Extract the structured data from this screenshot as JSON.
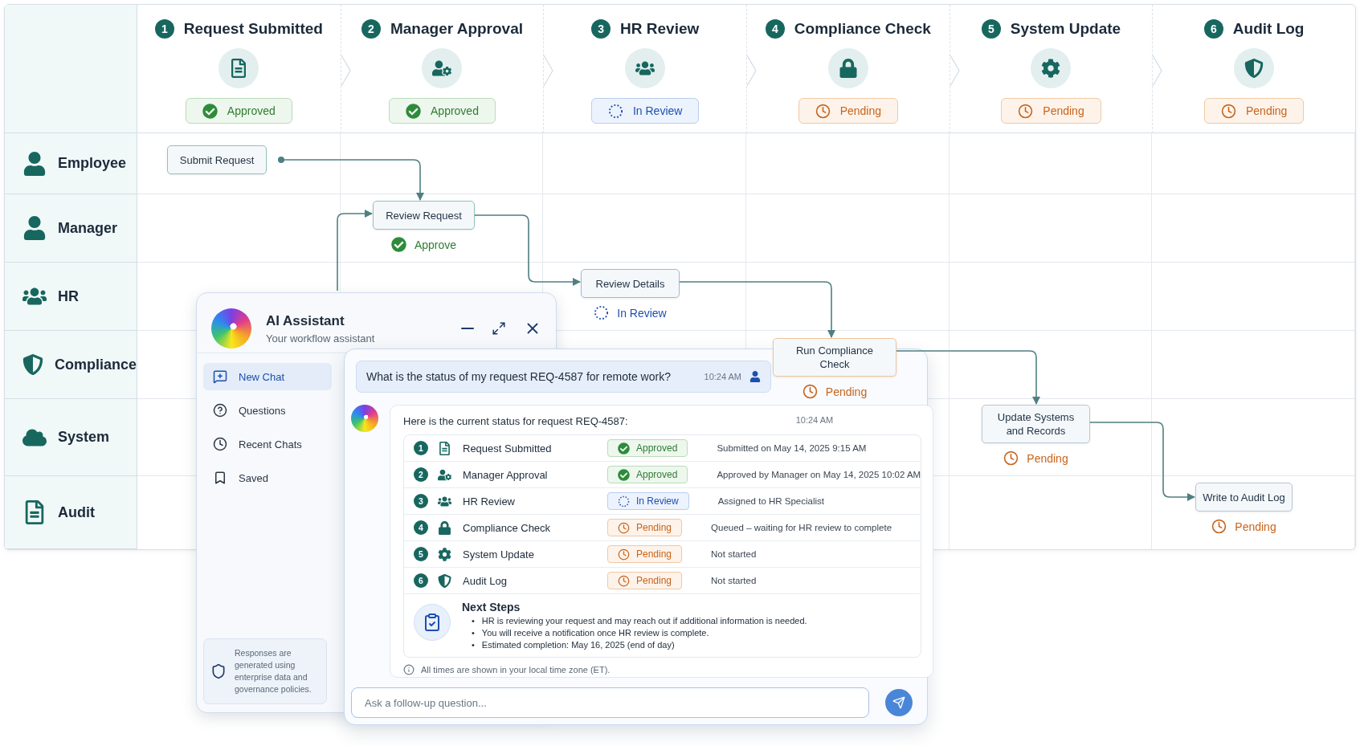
{
  "stages": [
    {
      "number": "1",
      "title": "Request Submitted",
      "status": {
        "kind": "approved",
        "label": "Approved"
      }
    },
    {
      "number": "2",
      "title": "Manager Approval",
      "status": {
        "kind": "approved",
        "label": "Approved"
      }
    },
    {
      "number": "3",
      "title": "HR Review",
      "status": {
        "kind": "in_review",
        "label": "In Review"
      }
    },
    {
      "number": "4",
      "title": "Compliance Check",
      "status": {
        "kind": "pending",
        "label": "Pending"
      }
    },
    {
      "number": "5",
      "title": "System Update",
      "status": {
        "kind": "pending",
        "label": "Pending"
      }
    },
    {
      "number": "6",
      "title": "Audit Log",
      "status": {
        "kind": "pending",
        "label": "Pending"
      }
    }
  ],
  "lanes": [
    {
      "name": "Employee"
    },
    {
      "name": "Manager"
    },
    {
      "name": "HR"
    },
    {
      "name": "Compliance"
    },
    {
      "name": "System"
    },
    {
      "name": "Audit"
    }
  ],
  "flow_nodes": [
    {
      "label": "Submit Request",
      "color": "#8fc4b8"
    },
    {
      "label": "Review Request",
      "color": "#8fc4b8",
      "status": {
        "kind": "approved",
        "label": "Approve"
      }
    },
    {
      "label": "Review Details",
      "color": "#9db9e6",
      "status": {
        "kind": "in_review",
        "label": "In Review"
      }
    },
    {
      "label": "Run Compliance Check",
      "color": "#efc49c",
      "status": {
        "kind": "pending",
        "label": "Pending"
      }
    },
    {
      "label": "Update Systems and Records",
      "color": "#b9c6d4",
      "status": {
        "kind": "pending",
        "label": "Pending"
      }
    },
    {
      "label": "Write to Audit Log",
      "color": "#b9c6d4",
      "status": {
        "kind": "pending",
        "label": "Pending"
      }
    }
  ],
  "assistant": {
    "title": "AI Assistant",
    "subtitle": "Your workflow assistant",
    "nav": [
      {
        "label": "New Chat",
        "selected": true
      },
      {
        "label": "Questions",
        "selected": false
      },
      {
        "label": "Recent Chats",
        "selected": false
      },
      {
        "label": "Saved",
        "selected": false
      }
    ],
    "note": "Responses are generated using enterprise data and governance policies.",
    "user_message": {
      "text": "What is the status of my request REQ-4587 for remote work?",
      "time": "10:24 AM"
    },
    "reply": {
      "intro": "Here is the current status for request REQ-4587:",
      "time": "10:24 AM",
      "rows": [
        {
          "number": "1",
          "step": "Request Submitted",
          "status": {
            "kind": "approved",
            "label": "Approved"
          },
          "detail": "Submitted on May 14, 2025  9:15 AM"
        },
        {
          "number": "2",
          "step": "Manager Approval",
          "status": {
            "kind": "approved",
            "label": "Approved"
          },
          "detail": "Approved by Manager on May 14, 2025 10:02 AM"
        },
        {
          "number": "3",
          "step": "HR Review",
          "status": {
            "kind": "in_review",
            "label": "In Review"
          },
          "detail": "Assigned to HR Specialist"
        },
        {
          "number": "4",
          "step": "Compliance Check",
          "status": {
            "kind": "pending",
            "label": "Pending"
          },
          "detail": "Queued – waiting for HR review to complete"
        },
        {
          "number": "5",
          "step": "System Update",
          "status": {
            "kind": "pending",
            "label": "Pending"
          },
          "detail": "Not started"
        },
        {
          "number": "6",
          "step": "Audit Log",
          "status": {
            "kind": "pending",
            "label": "Pending"
          },
          "detail": "Not started"
        }
      ],
      "next_steps": {
        "title": "Next Steps",
        "items": [
          {
            "marker": "•",
            "text": "HR is reviewing your request and may reach out if additional information is needed."
          },
          {
            "marker": "•",
            "text": "You will receive a notification once HR review is complete."
          },
          {
            "marker": "•",
            "text": "Estimated completion: May 16, 2025 (end of day)"
          }
        ]
      },
      "footnote": "All times are shown in your local time zone (ET)."
    },
    "input": {
      "placeholder": "Ask a follow-up question..."
    }
  }
}
